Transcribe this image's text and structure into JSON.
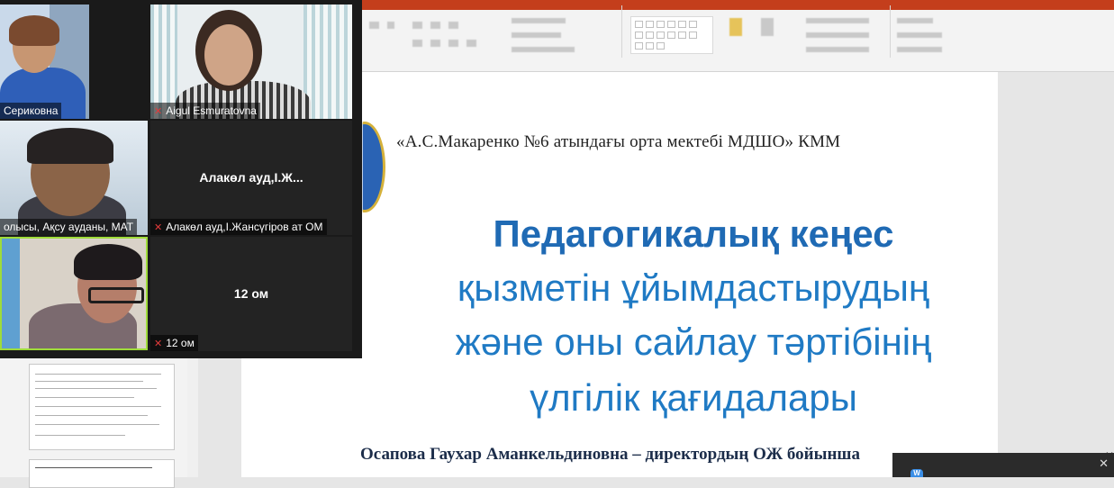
{
  "zoom": {
    "tiles": [
      {
        "name": "Сериковна",
        "muted": false
      },
      {
        "name": "Aigul Esmuratovna",
        "muted": true
      },
      {
        "name": "олысы, Ақсу ауданы, МАТ",
        "muted": false
      },
      {
        "name": "Алакөл ауд,І.Жансүгіров ат ОМ",
        "muted": true,
        "center_label": "Алакөл ауд,І.Ж..."
      },
      {
        "name": "",
        "muted": false
      },
      {
        "name": "12 ом",
        "muted": true,
        "center_label": "12 ом"
      }
    ]
  },
  "slide": {
    "header": "«А.С.Макаренко №6 атындағы орта мектебі МДШО» КММ",
    "title_lines": [
      "Педагогикалық кеңес",
      "қызметін ұйымдастырудың",
      "және оны сайлау тәртібінің",
      "үлгілік қағидалары"
    ],
    "author": "Осапова Гаухар Аманкельдиновна – директордың ОЖ бойынша"
  },
  "notification": {
    "badge": "W"
  }
}
